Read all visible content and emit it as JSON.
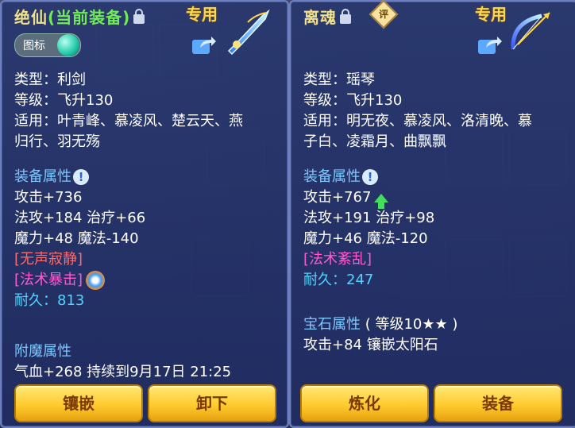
{
  "left_panel": {
    "title_name": "绝仙",
    "title_status": "(当前装备)",
    "special_tag": "专用",
    "badge_label": "图标",
    "type_line": "类型：利剑",
    "level_line": "等级：飞升130",
    "apply_line1": "适用：叶青峰、慕凌风、楚云天、燕",
    "apply_line2": "归行、羽无殇",
    "section_attr": "装备属性",
    "attack": "攻击+736",
    "magic_heal": "法攻+184 治疗+66",
    "power_mana": "魔力+48 魔法-140",
    "skill1": "[无声寂静]",
    "skill2": "[法术暴击]",
    "durability": "耐久：813",
    "section_enchant": "附魔属性",
    "enchant_text": "气血+268 持续到9月17日 21:25",
    "button_left": "镶嵌",
    "button_right": "卸下"
  },
  "right_panel": {
    "title_name": "离魂",
    "eval_icon_text": "评",
    "special_tag": "专用",
    "type_line": "类型：瑶琴",
    "level_line": "等级：飞升130",
    "apply_line1": "适用：明无夜、慕凌风、洛清晚、慕",
    "apply_line2": "子白、凌霜月、曲飘飘",
    "section_attr": "装备属性",
    "attack": "攻击+767",
    "magic_heal": "法攻+191 治疗+98",
    "power_mana": "魔力+46 魔法-120",
    "skill1": "[法术紊乱]",
    "durability": "耐久：247",
    "section_gem": "宝石属性",
    "gem_level": "( 等级10★★ )",
    "gem_text": "攻击+84 镶嵌太阳石",
    "button_left": "炼化",
    "button_right": "装备"
  },
  "icons": [
    "lock-icon",
    "share-icon",
    "info-icon",
    "sword-icon",
    "bow-icon",
    "up-arrow-icon",
    "refresh-icon"
  ]
}
